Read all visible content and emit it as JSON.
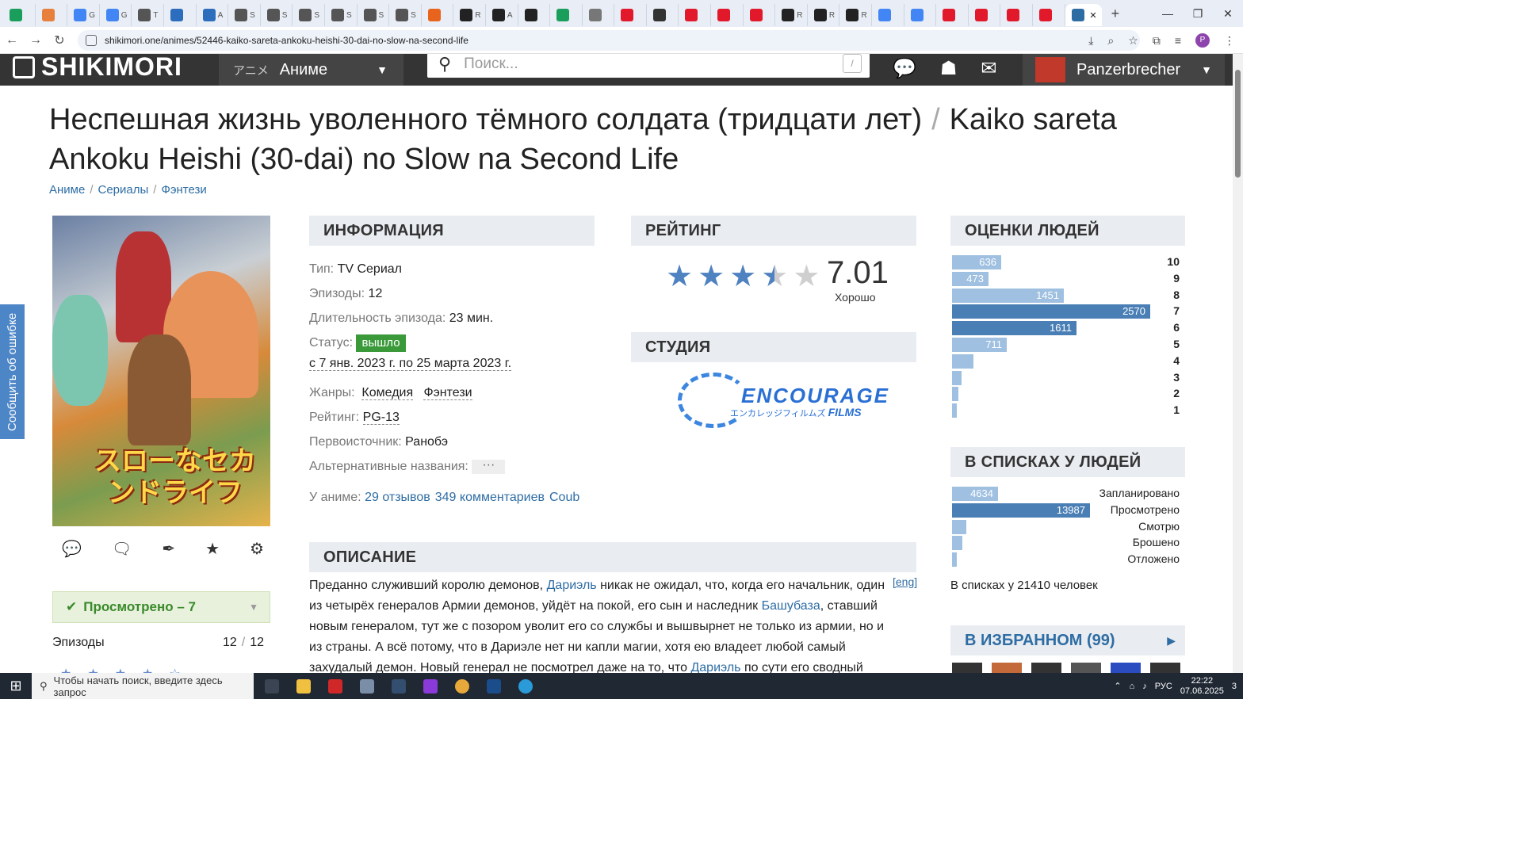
{
  "browser": {
    "tabs": [
      {
        "icon_color": "#1a9e5c",
        "label": ""
      },
      {
        "icon_color": "#e6803c",
        "label": ""
      },
      {
        "icon_color": "#4285f4",
        "label": "G"
      },
      {
        "icon_color": "#4285f4",
        "label": "G"
      },
      {
        "icon_color": "#555555",
        "label": "T"
      },
      {
        "icon_color": "#2c6ebd",
        "label": ""
      },
      {
        "icon_color": "#2c6ebd",
        "label": "A"
      },
      {
        "icon_color": "#555555",
        "label": "S"
      },
      {
        "icon_color": "#555555",
        "label": "S"
      },
      {
        "icon_color": "#555555",
        "label": "S"
      },
      {
        "icon_color": "#555555",
        "label": "S"
      },
      {
        "icon_color": "#555555",
        "label": "S"
      },
      {
        "icon_color": "#555555",
        "label": "S"
      },
      {
        "icon_color": "#e8631c",
        "label": ""
      },
      {
        "icon_color": "#222222",
        "label": "R"
      },
      {
        "icon_color": "#222222",
        "label": "A"
      },
      {
        "icon_color": "#222222",
        "label": ""
      },
      {
        "icon_color": "#1a9e5c",
        "label": ""
      },
      {
        "icon_color": "#777777",
        "label": ""
      },
      {
        "icon_color": "#e2182b",
        "label": ""
      },
      {
        "icon_color": "#333333",
        "label": ""
      },
      {
        "icon_color": "#e2182b",
        "label": ""
      },
      {
        "icon_color": "#e2182b",
        "label": ""
      },
      {
        "icon_color": "#e2182b",
        "label": ""
      },
      {
        "icon_color": "#222222",
        "label": "R"
      },
      {
        "icon_color": "#222222",
        "label": "R"
      },
      {
        "icon_color": "#222222",
        "label": "R"
      },
      {
        "icon_color": "#4285f4",
        "label": ""
      },
      {
        "icon_color": "#4285f4",
        "label": ""
      },
      {
        "icon_color": "#e2182b",
        "label": ""
      },
      {
        "icon_color": "#e2182b",
        "label": ""
      },
      {
        "icon_color": "#e2182b",
        "label": ""
      },
      {
        "icon_color": "#e2182b",
        "label": ""
      }
    ],
    "active_tab_close": "✕",
    "new_tab": "+",
    "window": {
      "minimize": "—",
      "restore": "❐",
      "close": "✕"
    },
    "url": "shikimori.one/animes/52446-kaiko-sareta-ankoku-heishi-30-dai-no-slow-na-second-life",
    "profile_initial": "P"
  },
  "site": {
    "logo": "SHIKIMORI",
    "menu_jp": "アニメ",
    "menu_label": "Аниме",
    "search_placeholder": "Поиск...",
    "search_hotkey": "/",
    "username": "Panzerbrecher",
    "report_tab": "Сообщить об ошибке"
  },
  "anime": {
    "title_ru": "Неспешная жизнь уволенного тёмного солдата (тридцати лет)",
    "title_sep": "/",
    "title_romaji": "Kaiko sareta Ankoku Heishi (30-dai) no Slow na Second Life",
    "breadcrumbs": [
      "Аниме",
      "Сериалы",
      "Фэнтези"
    ],
    "poster_title": "スローなセカンドライフ",
    "status_button": "Просмотрено – 7",
    "episodes_label": "Эпизоды",
    "episodes_watched": "12",
    "episodes_total": "12"
  },
  "info": {
    "header": "ИНФОРМАЦИЯ",
    "type_k": "Тип:",
    "type_v": "TV Сериал",
    "episodes_k": "Эпизоды:",
    "episodes_v": "12",
    "duration_k": "Длительность эпизода:",
    "duration_v": "23 мин.",
    "status_k": "Статус:",
    "status_v": "вышло",
    "dates": "с 7 янв. 2023 г. по 25 марта 2023 г.",
    "genres_k": "Жанры:",
    "genre1": "Комедия",
    "genre2": "Фэнтези",
    "rating_k": "Рейтинг:",
    "rating_v": "PG-13",
    "source_k": "Первоисточник:",
    "source_v": "Ранобэ",
    "alt_k": "Альтернативные названия:",
    "alt_v": "···",
    "about_k": "У аниме:",
    "reviews": "29 отзывов",
    "comments": "349 комментариев",
    "coub": "Coub"
  },
  "rating": {
    "header": "РЕЙТИНГ",
    "score": "7.01",
    "label": "Хорошо",
    "stars_filled": 3.5
  },
  "studio": {
    "header": "СТУДИЯ",
    "name": "ENCOURAGE",
    "films": "FILMS",
    "jp": "エンカレッジフィルムズ"
  },
  "description": {
    "header": "ОПИСАНИЕ",
    "eng_link": "[eng]",
    "p1": "Преданно служивший королю демонов, ",
    "link1": "Дариэль",
    "p2": " никак не ожидал, что, когда его начальник, один из четырёх генералов Армии демонов, уйдёт на покой, его сын и наследник ",
    "link2": "Башубаза",
    "p3": ", ставший новым генералом, тут же с позором уволит его со службы и вышвырнет не только из армии, но и из страны. А всё потому, что в Дариэле нет ни капли магии, хотя ею владеет любой самый захудалый демон. Новый генерал не посмотрел даже на то, что ",
    "link3": "Дариэль",
    "p4": " по сути его сводный брат"
  },
  "scores": {
    "header": "ОЦЕНКИ ЛЮДЕЙ",
    "rows": [
      {
        "score": "10",
        "count": 636
      },
      {
        "score": "9",
        "count": 473
      },
      {
        "score": "8",
        "count": 1451
      },
      {
        "score": "7",
        "count": 2570
      },
      {
        "score": "6",
        "count": 1611
      },
      {
        "score": "5",
        "count": 711
      },
      {
        "score": "4",
        "count": ""
      },
      {
        "score": "3",
        "count": ""
      },
      {
        "score": "2",
        "count": ""
      },
      {
        "score": "1",
        "count": ""
      }
    ]
  },
  "lists": {
    "header": "В СПИСКАХ У ЛЮДЕЙ",
    "rows": [
      {
        "label": "Запланировано",
        "count": 4634
      },
      {
        "label": "Просмотрено",
        "count": 13987
      },
      {
        "label": "Смотрю",
        "count": ""
      },
      {
        "label": "Брошено",
        "count": ""
      },
      {
        "label": "Отложено",
        "count": ""
      }
    ],
    "total": "В списках у 21410 человек"
  },
  "favorites": {
    "header": "В ИЗБРАННОМ",
    "count": "99"
  },
  "taskbar": {
    "search_placeholder": "Чтобы начать поиск, введите здесь запрос",
    "lang": "РУС",
    "time": "22:22",
    "date": "07.06.2025",
    "notif": "3"
  },
  "colors": {
    "accent": "#2e6da4",
    "bar_light": "#9fc0e0",
    "bar_dark": "#4a7fb5",
    "status_green": "#3a9a3a"
  }
}
